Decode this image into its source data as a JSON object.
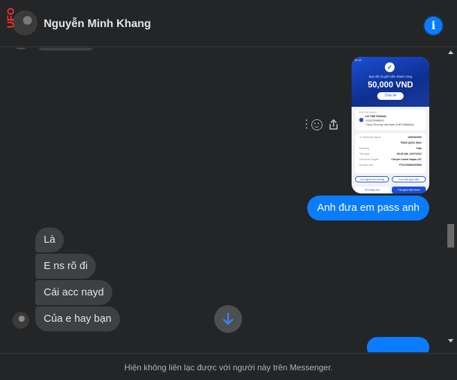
{
  "header": {
    "contact_name": "Nguyễn Minh Khang",
    "avatar_overlay_text": "UFO",
    "info_icon": "info-circle-icon"
  },
  "receipt": {
    "subtitle": "Bạn đã chuyển tiền thành công",
    "amount": "50,000 VND",
    "share_label": "Chia sẻ",
    "sender_label": "Đến tài khoản",
    "recipient_name": "LE THE PHONG",
    "recipient_account": "101870989043",
    "recipient_bank": "Công Thương Việt Nam (VIETINBANK)",
    "rows": [
      {
        "label": "Từ tài khoản nguồn",
        "value": "1900432006"
      },
      {
        "label": "",
        "value": "TRAN QUOC BAO"
      },
      {
        "label": "Nội dung",
        "value": "Cấty"
      },
      {
        "label": "Thời gian",
        "value": "08:35 AM, 12/07/2022"
      },
      {
        "label": "Hình thức chuyển",
        "value": "Chuyển nhanh Napas 247"
      },
      {
        "label": "Mã giao dịch",
        "value": "FT22193860603965"
      }
    ],
    "btn_save_recipient": "Lưu người thụ hưởng",
    "btn_save_template": "Lưu mẫu giao dịch",
    "btn_home": "Về trang chủ",
    "btn_new": "Tạo giao dịch khác"
  },
  "messages": {
    "outgoing": [
      {
        "text": "Anh đưa em pass anh"
      }
    ],
    "incoming": [
      {
        "text": "Là"
      },
      {
        "text": "E ns rõ đi"
      },
      {
        "text": "Cái acc nayd"
      },
      {
        "text": "Của e hay bạn"
      }
    ]
  },
  "message_actions": {
    "more": "⋮",
    "react_icon": "smile-icon",
    "share_icon": "share-icon"
  },
  "footer": {
    "notice": "Hiện không liên lạc được với người này trên Messenger."
  },
  "colors": {
    "background": "#242526",
    "outgoing_bubble": "#0a7cff",
    "incoming_bubble": "#3e4042",
    "text_primary": "#e4e6eb",
    "text_secondary": "#b0b3b8"
  }
}
